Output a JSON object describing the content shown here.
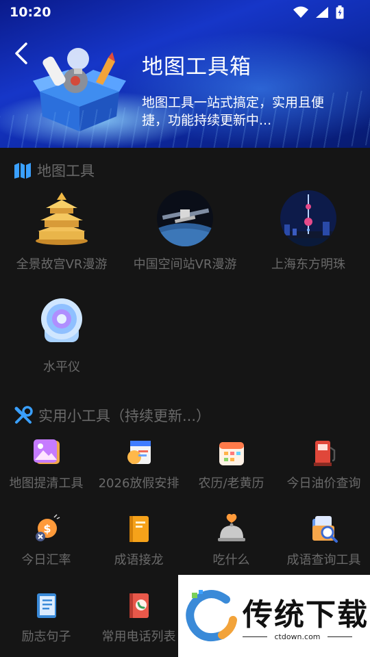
{
  "status": {
    "time": "10:20"
  },
  "header": {
    "title": "地图工具箱",
    "description": "地图工具一站式搞定，实用且便捷，功能持续更新中..."
  },
  "sections": [
    {
      "title": "地图工具",
      "icon": "map-icon",
      "items": [
        {
          "label": "全景故宫VR漫游",
          "icon": "temple-image"
        },
        {
          "label": "中国空间站VR漫游",
          "icon": "space-station-image"
        },
        {
          "label": "上海东方明珠",
          "icon": "pearl-tower-image"
        },
        {
          "label": "水平仪",
          "icon": "level-icon"
        }
      ]
    },
    {
      "title": "实用小工具（持续更新...）",
      "icon": "tools-icon",
      "items": [
        {
          "label": "地图提清工具",
          "icon": "photo-icon"
        },
        {
          "label": "2026放假安排",
          "icon": "schedule-icon"
        },
        {
          "label": "农历/老黄历",
          "icon": "calendar-icon"
        },
        {
          "label": "今日油价查询",
          "icon": "fuel-pump-icon"
        },
        {
          "label": "今日汇率",
          "icon": "exchange-coin-icon"
        },
        {
          "label": "成语接龙",
          "icon": "book-icon"
        },
        {
          "label": "吃什么",
          "icon": "food-cloche-icon"
        },
        {
          "label": "成语查询工具",
          "icon": "search-folder-icon"
        },
        {
          "label": "励志句子",
          "icon": "notebook-icon"
        },
        {
          "label": "常用电话列表",
          "icon": "phone-book-icon"
        }
      ]
    }
  ],
  "watermark": {
    "brand": "传统下载",
    "url": "ctdown.com"
  },
  "colors": {
    "accent": "#3aa0ff",
    "background": "#151515",
    "text": "#6a6a6a"
  }
}
